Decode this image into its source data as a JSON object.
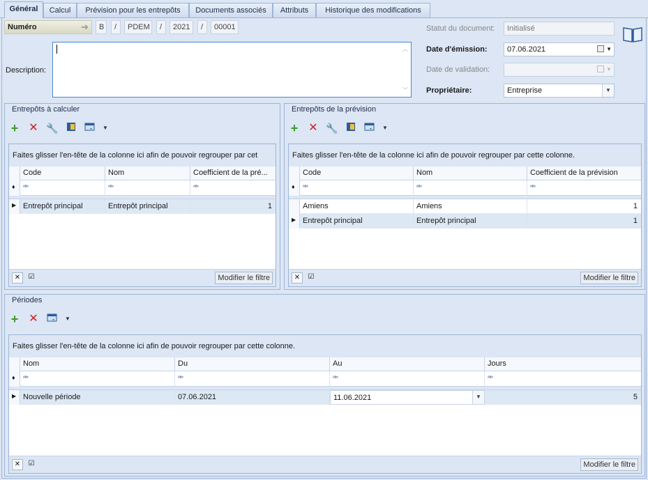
{
  "tabs": [
    "Général",
    "Calcul",
    "Prévision pour les entrepôts",
    "Documents associés",
    "Attributs",
    "Historique des modifications"
  ],
  "header": {
    "numero_label": "Numéro",
    "num_parts": [
      "B",
      "PDEM",
      "2021",
      "00001"
    ],
    "slash": "/",
    "description_label": "Description:",
    "description_value": "",
    "statut_label": "Statut du document:",
    "statut_value": "Initialisé",
    "emission_label": "Date d'émission:",
    "emission_value": "07.06.2021",
    "validation_label": "Date de validation:",
    "validation_value": "",
    "proprietaire_label": "Propriétaire:",
    "proprietaire_value": "Entreprise"
  },
  "colors": {
    "accent": "#3b7a3b",
    "delete": "#d02020"
  },
  "group_prompt_short": "Faites glisser l'en-tête de la colonne ici afin de pouvoir regrouper par cet",
  "group_prompt": "Faites glisser l'en-tête de la colonne ici afin de pouvoir regrouper par cette colonne.",
  "modify_filter": "Modifier le filtre",
  "warehouses_calc": {
    "title": "Entrepôts à calculer",
    "columns": [
      "Code",
      "Nom",
      "Coefficient de la pré..."
    ],
    "rows": [
      {
        "code": "Entrepôt principal",
        "nom": "Entrepôt principal",
        "coef": "1"
      }
    ]
  },
  "warehouses_prev": {
    "title": "Entrepôts de la prévision",
    "columns": [
      "Code",
      "Nom",
      "Coefficient de la prévision"
    ],
    "rows": [
      {
        "code": "Amiens",
        "nom": "Amiens",
        "coef": "1"
      },
      {
        "code": "Entrepôt principal",
        "nom": "Entrepôt principal",
        "coef": "1"
      }
    ]
  },
  "periods": {
    "title": "Périodes",
    "columns": [
      "Nom",
      "Du",
      "Au",
      "Jours"
    ],
    "rows": [
      {
        "nom": "Nouvelle période",
        "du": "07.06.2021",
        "au": "11.06.2021",
        "jours": "5"
      }
    ]
  },
  "icons": [
    "add-icon",
    "delete-icon",
    "wrench-icon",
    "book-icon",
    "view-icon",
    "chevron-down-icon",
    "pin-icon",
    "row-indicator-icon",
    "clear-filter-icon",
    "checkbox-icon",
    "calendar-icon",
    "help-book-icon"
  ]
}
